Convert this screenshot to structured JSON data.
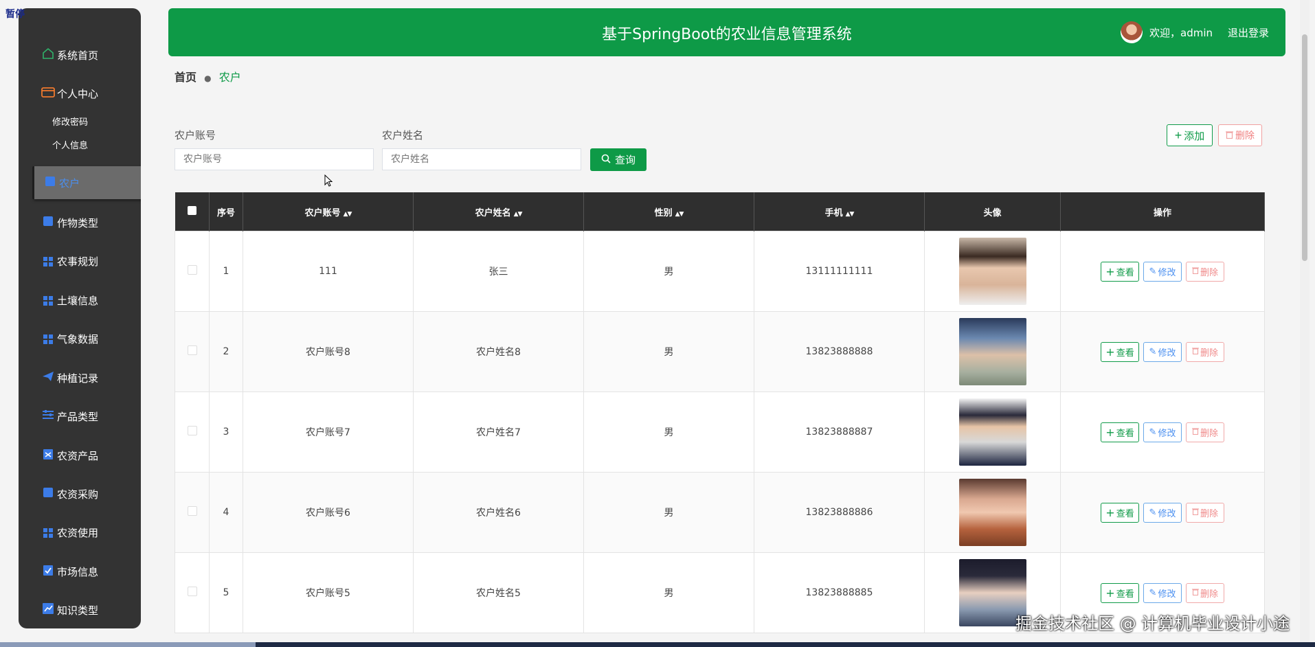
{
  "overlay": {
    "paused_label": "暂停",
    "watermark": "掘金技术社区 @ 计算机毕业设计小途"
  },
  "header": {
    "title": "基于SpringBoot的农业信息管理系统",
    "welcome": "欢迎，admin",
    "logout": "退出登录"
  },
  "sidebar": {
    "home": "系统首页",
    "personal": "个人中心",
    "change_password": "修改密码",
    "personal_info": "个人信息",
    "items": [
      "农户",
      "作物类型",
      "农事规划",
      "土壤信息",
      "气象数据",
      "种植记录",
      "产品类型",
      "农资产品",
      "农资采购",
      "农资使用",
      "市场信息",
      "知识类型"
    ],
    "active": "农户"
  },
  "breadcrumb": {
    "home": "首页",
    "current": "农户"
  },
  "search": {
    "account_label": "农户账号",
    "account_placeholder": "农户账号",
    "name_label": "农户姓名",
    "name_placeholder": "农户姓名",
    "query_button": "查询"
  },
  "toolbar": {
    "add": "添加",
    "delete": "删除"
  },
  "table": {
    "headers": [
      "序号",
      "农户账号",
      "农户姓名",
      "性别",
      "手机",
      "头像",
      "操作"
    ],
    "rows": [
      {
        "index": "1",
        "account": "111",
        "name": "张三",
        "gender": "男",
        "phone": "13111111111"
      },
      {
        "index": "2",
        "account": "农户账号8",
        "name": "农户姓名8",
        "gender": "男",
        "phone": "13823888888"
      },
      {
        "index": "3",
        "account": "农户账号7",
        "name": "农户姓名7",
        "gender": "男",
        "phone": "13823888887"
      },
      {
        "index": "4",
        "account": "农户账号6",
        "name": "农户姓名6",
        "gender": "男",
        "phone": "13823888886"
      },
      {
        "index": "5",
        "account": "农户账号5",
        "name": "农户姓名5",
        "gender": "男",
        "phone": "13823888885"
      }
    ],
    "ops": {
      "view": "查看",
      "edit": "修改",
      "delete": "删除"
    }
  },
  "colors": {
    "brand_green": "#0e9a47",
    "sidebar_bg": "#333333",
    "table_header": "#2f2f2f",
    "icon_blue": "#3c7ce8"
  }
}
